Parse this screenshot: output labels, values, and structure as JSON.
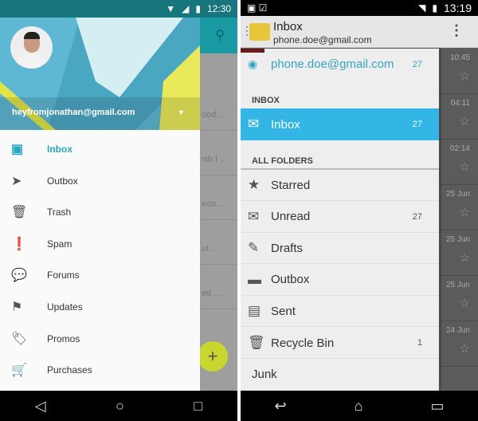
{
  "left": {
    "status": {
      "time": "12:30",
      "icons": [
        "wifi-icon",
        "signal-icon",
        "battery-icon"
      ]
    },
    "account_email": "heyfromjonathan@gmail.com",
    "background_snippets": [
      "ood ...",
      "ish I ...",
      "eco...",
      "ut ...",
      "ed ..."
    ],
    "nav": [
      {
        "label": "Inbox",
        "icon": "inbox-icon",
        "glyph": "▣",
        "active": true
      },
      {
        "label": "Outbox",
        "icon": "send-icon",
        "glyph": "➤"
      },
      {
        "label": "Trash",
        "icon": "trash-icon",
        "glyph": "🗑"
      },
      {
        "label": "Spam",
        "icon": "spam-icon",
        "glyph": "❗"
      },
      {
        "label": "Forums",
        "icon": "forum-icon",
        "glyph": "💬"
      },
      {
        "label": "Updates",
        "icon": "flag-icon",
        "glyph": "⚑"
      },
      {
        "label": "Promos",
        "icon": "tag-icon",
        "glyph": "🏷"
      },
      {
        "label": "Purchases",
        "icon": "cart-icon",
        "glyph": "🛒"
      }
    ],
    "accent": "#26a9c1",
    "fab_label": "+"
  },
  "right": {
    "status": {
      "time": "13:19"
    },
    "title": "Inbox",
    "subtitle": "phone.doe@gmail.com",
    "account": {
      "email": "phone.doe@gmail.com",
      "count": "27"
    },
    "inbox_section": "INBOX",
    "inbox_item": {
      "label": "Inbox",
      "count": "27"
    },
    "folders_section": "ALL FOLDERS",
    "folders": [
      {
        "label": "Starred",
        "icon": "star-icon",
        "glyph": "★",
        "count": ""
      },
      {
        "label": "Unread",
        "icon": "unread-icon",
        "glyph": "✉",
        "count": "27"
      },
      {
        "label": "Drafts",
        "icon": "drafts-icon",
        "glyph": "✎",
        "count": ""
      },
      {
        "label": "Outbox",
        "icon": "outbox-icon",
        "glyph": "▬",
        "count": ""
      },
      {
        "label": "Sent",
        "icon": "sent-icon",
        "glyph": "▤",
        "count": ""
      },
      {
        "label": "Recycle Bin",
        "icon": "trash-icon",
        "glyph": "🗑",
        "count": "1"
      },
      {
        "label": "Junk",
        "icon": "",
        "glyph": "",
        "count": ""
      }
    ],
    "bg_times": [
      "10:45",
      "04:11",
      "02:14",
      "25 Jun",
      "25 Jun",
      "25 Jun",
      "24 Jun"
    ],
    "selected_color": "#33b5e5"
  }
}
